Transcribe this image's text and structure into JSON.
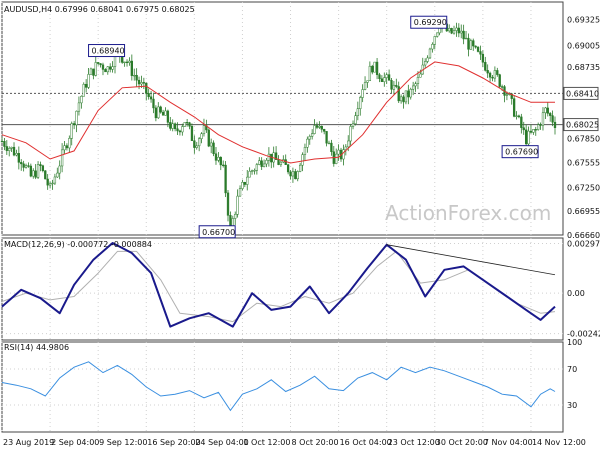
{
  "chart_data": [
    {
      "type": "candlestick",
      "panel": "price",
      "title": "AUDUSD,H4  0.67996 0.68041 0.67975 0.68025",
      "ylim": [
        0.6666,
        0.6954
      ],
      "yticks": [
        "0.69325",
        "0.69005",
        "0.68735",
        "0.68410",
        "0.68025",
        "0.67850",
        "0.67555",
        "0.67250",
        "0.66955",
        "0.66660"
      ],
      "ytick_values": [
        0.69325,
        0.69005,
        0.68735,
        0.6841,
        0.68025,
        0.6785,
        0.67555,
        0.6725,
        0.66955,
        0.6666
      ],
      "highlighted_levels": [
        {
          "label": "0.68410",
          "value": 0.6841,
          "style": "dotted"
        },
        {
          "label": "0.68025",
          "value": 0.68025,
          "style": "solid"
        }
      ],
      "price_labels": [
        {
          "text": "0.68940",
          "value": 0.6894
        },
        {
          "text": "0.69290",
          "value": 0.6929
        },
        {
          "text": "0.67690",
          "value": 0.6769
        },
        {
          "text": "0.66700",
          "value": 0.667
        }
      ],
      "close_path": [
        [
          0,
          0.6782
        ],
        [
          4,
          0.6772
        ],
        [
          8,
          0.676
        ],
        [
          12,
          0.6738
        ],
        [
          16,
          0.675
        ],
        [
          20,
          0.6722
        ],
        [
          24,
          0.6755
        ],
        [
          28,
          0.679
        ],
        [
          32,
          0.683
        ],
        [
          36,
          0.6862
        ],
        [
          40,
          0.6878
        ],
        [
          44,
          0.6872
        ],
        [
          48,
          0.6892
        ],
        [
          52,
          0.688
        ],
        [
          56,
          0.6858
        ],
        [
          60,
          0.6842
        ],
        [
          64,
          0.6818
        ],
        [
          68,
          0.6812
        ],
        [
          72,
          0.6792
        ],
        [
          76,
          0.6808
        ],
        [
          80,
          0.678
        ],
        [
          84,
          0.6795
        ],
        [
          88,
          0.677
        ],
        [
          92,
          0.6745
        ],
        [
          95,
          0.6672
        ],
        [
          98,
          0.671
        ],
        [
          102,
          0.674
        ],
        [
          106,
          0.6752
        ],
        [
          110,
          0.6765
        ],
        [
          114,
          0.6758
        ],
        [
          118,
          0.675
        ],
        [
          122,
          0.6742
        ],
        [
          126,
          0.6775
        ],
        [
          130,
          0.6802
        ],
        [
          134,
          0.679
        ],
        [
          138,
          0.6762
        ],
        [
          142,
          0.6765
        ],
        [
          146,
          0.681
        ],
        [
          150,
          0.685
        ],
        [
          154,
          0.6875
        ],
        [
          158,
          0.6862
        ],
        [
          162,
          0.6852
        ],
        [
          166,
          0.6832
        ],
        [
          170,
          0.6842
        ],
        [
          174,
          0.6862
        ],
        [
          178,
          0.69
        ],
        [
          182,
          0.6928
        ],
        [
          186,
          0.6915
        ],
        [
          190,
          0.6918
        ],
        [
          194,
          0.6902
        ],
        [
          198,
          0.6888
        ],
        [
          202,
          0.6872
        ],
        [
          206,
          0.686
        ],
        [
          210,
          0.6842
        ],
        [
          214,
          0.6812
        ],
        [
          218,
          0.6785
        ],
        [
          222,
          0.6795
        ],
        [
          226,
          0.682
        ],
        [
          230,
          0.6805
        ]
      ],
      "series": [
        {
          "name": "",
          "kind": "moving-average",
          "color": "#e03030",
          "points": [
            [
              0,
              0.679
            ],
            [
              10,
              0.678
            ],
            [
              20,
              0.676
            ],
            [
              30,
              0.677
            ],
            [
              40,
              0.682
            ],
            [
              50,
              0.6848
            ],
            [
              60,
              0.685
            ],
            [
              70,
              0.683
            ],
            [
              80,
              0.6812
            ],
            [
              90,
              0.679
            ],
            [
              100,
              0.6775
            ],
            [
              110,
              0.6764
            ],
            [
              120,
              0.6755
            ],
            [
              130,
              0.676
            ],
            [
              140,
              0.6762
            ],
            [
              150,
              0.679
            ],
            [
              160,
              0.683
            ],
            [
              170,
              0.686
            ],
            [
              180,
              0.688
            ],
            [
              190,
              0.6875
            ],
            [
              200,
              0.686
            ],
            [
              210,
              0.6842
            ],
            [
              220,
              0.683
            ],
            [
              230,
              0.683
            ]
          ]
        }
      ]
    },
    {
      "type": "line",
      "panel": "macd",
      "title": "MACD(12,26,9) -0.000772 -0.000884",
      "ylim": [
        -0.0028,
        0.0033
      ],
      "yticks": [
        "0.00297",
        "0.00",
        "-0.00242"
      ],
      "ytick_values": [
        0.00297,
        0.0,
        -0.00242
      ],
      "series": [
        {
          "name": "",
          "role": "macd",
          "color": "#1a1a8c",
          "points": [
            [
              0,
              -0.0008
            ],
            [
              8,
              0.0002
            ],
            [
              16,
              -0.0003
            ],
            [
              24,
              -0.0012
            ],
            [
              30,
              0.0005
            ],
            [
              38,
              0.002
            ],
            [
              46,
              0.003
            ],
            [
              54,
              0.0024
            ],
            [
              62,
              0.0012
            ],
            [
              70,
              -0.002
            ],
            [
              78,
              -0.0015
            ],
            [
              86,
              -0.0012
            ],
            [
              96,
              -0.002
            ],
            [
              104,
              0.0
            ],
            [
              112,
              -0.001
            ],
            [
              120,
              -0.0008
            ],
            [
              128,
              0.0004
            ],
            [
              136,
              -0.0012
            ],
            [
              144,
              0.0
            ],
            [
              152,
              0.0015
            ],
            [
              160,
              0.0029
            ],
            [
              168,
              0.002
            ],
            [
              176,
              -0.0002
            ],
            [
              184,
              0.0014
            ],
            [
              192,
              0.0016
            ],
            [
              200,
              0.0008
            ],
            [
              210,
              -0.0002
            ],
            [
              218,
              -0.001
            ],
            [
              224,
              -0.0016
            ],
            [
              230,
              -0.0008
            ]
          ]
        },
        {
          "name": "",
          "role": "signal",
          "color": "#b0b0b0",
          "points": [
            [
              0,
              -0.0005
            ],
            [
              10,
              0.0
            ],
            [
              20,
              -0.0004
            ],
            [
              30,
              -0.0002
            ],
            [
              40,
              0.0012
            ],
            [
              48,
              0.0025
            ],
            [
              56,
              0.0025
            ],
            [
              66,
              0.0008
            ],
            [
              74,
              -0.0012
            ],
            [
              86,
              -0.0014
            ],
            [
              96,
              -0.0017
            ],
            [
              106,
              -0.0006
            ],
            [
              116,
              -0.0008
            ],
            [
              126,
              -0.0002
            ],
            [
              136,
              -0.0006
            ],
            [
              146,
              0.0
            ],
            [
              156,
              0.0016
            ],
            [
              164,
              0.0025
            ],
            [
              174,
              0.0006
            ],
            [
              184,
              0.0008
            ],
            [
              194,
              0.0014
            ],
            [
              204,
              0.0004
            ],
            [
              214,
              -0.0006
            ],
            [
              224,
              -0.0012
            ],
            [
              230,
              -0.0011
            ]
          ]
        }
      ],
      "trendline": [
        [
          160,
          0.0029
        ],
        [
          230,
          0.0011
        ]
      ]
    },
    {
      "type": "line",
      "panel": "rsi",
      "title": "RSI(14) 44.9806",
      "ylim": [
        0,
        100
      ],
      "yticks": [
        "100",
        "70",
        "30",
        "0"
      ],
      "ytick_values": [
        100,
        70,
        30,
        0
      ],
      "series": [
        {
          "name": "",
          "color": "#3a8fe0",
          "points": [
            [
              0,
              55
            ],
            [
              6,
              52
            ],
            [
              12,
              48
            ],
            [
              18,
              40
            ],
            [
              24,
              60
            ],
            [
              30,
              72
            ],
            [
              36,
              78
            ],
            [
              42,
              66
            ],
            [
              48,
              74
            ],
            [
              54,
              64
            ],
            [
              60,
              50
            ],
            [
              66,
              40
            ],
            [
              72,
              42
            ],
            [
              78,
              46
            ],
            [
              84,
              38
            ],
            [
              90,
              44
            ],
            [
              95,
              24
            ],
            [
              100,
              42
            ],
            [
              106,
              48
            ],
            [
              112,
              58
            ],
            [
              118,
              45
            ],
            [
              124,
              52
            ],
            [
              130,
              62
            ],
            [
              136,
              48
            ],
            [
              142,
              46
            ],
            [
              148,
              60
            ],
            [
              154,
              66
            ],
            [
              160,
              58
            ],
            [
              166,
              72
            ],
            [
              172,
              66
            ],
            [
              178,
              72
            ],
            [
              184,
              68
            ],
            [
              190,
              62
            ],
            [
              196,
              56
            ],
            [
              202,
              50
            ],
            [
              208,
              42
            ],
            [
              214,
              40
            ],
            [
              220,
              28
            ],
            [
              224,
              42
            ],
            [
              228,
              48
            ],
            [
              230,
              45
            ]
          ]
        }
      ]
    }
  ],
  "x_axis": {
    "labels": [
      "23 Aug 2019",
      "2 Sep 04:00",
      "9 Sep 12:00",
      "16 Sep 20:00",
      "24 Sep 04:00",
      "1 Oct 12:00",
      "8 Oct 20:00",
      "16 Oct 04:00",
      "23 Oct 12:00",
      "30 Oct 20:00",
      "7 Nov 04:00",
      "14 Nov 12:00"
    ],
    "label_index": [
      0,
      20,
      40,
      60,
      80,
      100,
      120,
      140,
      160,
      180,
      200,
      220
    ],
    "max_index": 230
  },
  "watermark": "ActionForex.com",
  "colors": {
    "candle_up": "#2a7a2a",
    "candle_down": "#2a7a2a",
    "grid": "#d0d0d0",
    "frame": "#444444",
    "label_border": "#1a1a8c"
  }
}
